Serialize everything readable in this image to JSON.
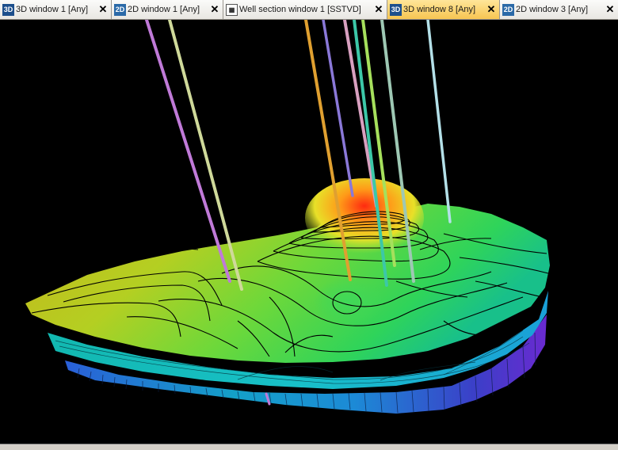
{
  "tabs": [
    {
      "icon": "3D",
      "label": "3D window 1 [Any]",
      "close": "✕",
      "active": false
    },
    {
      "icon": "2D",
      "label": "2D window 1 [Any]",
      "close": "✕",
      "active": false
    },
    {
      "icon": "▦",
      "label": "Well section window 1 [SSTVD]",
      "close": "✕",
      "active": false
    },
    {
      "icon": "3D",
      "label": "3D window 8 [Any]",
      "close": "✕",
      "active": true
    },
    {
      "icon": "2D",
      "label": "2D window 3 [Any]",
      "close": "✕",
      "active": false
    }
  ],
  "colors": {
    "tab_active": "#f7c552",
    "viewport_background": "#000000"
  },
  "scene": {
    "type": "3d-surface-with-wells",
    "well_colors": [
      "#c07ad8",
      "#cfd99a",
      "#e0a030",
      "#8a78d8",
      "#d8a0c0",
      "#3cc8a8",
      "#a6e05c",
      "#9ec8b4",
      "#b4e0e8"
    ]
  }
}
